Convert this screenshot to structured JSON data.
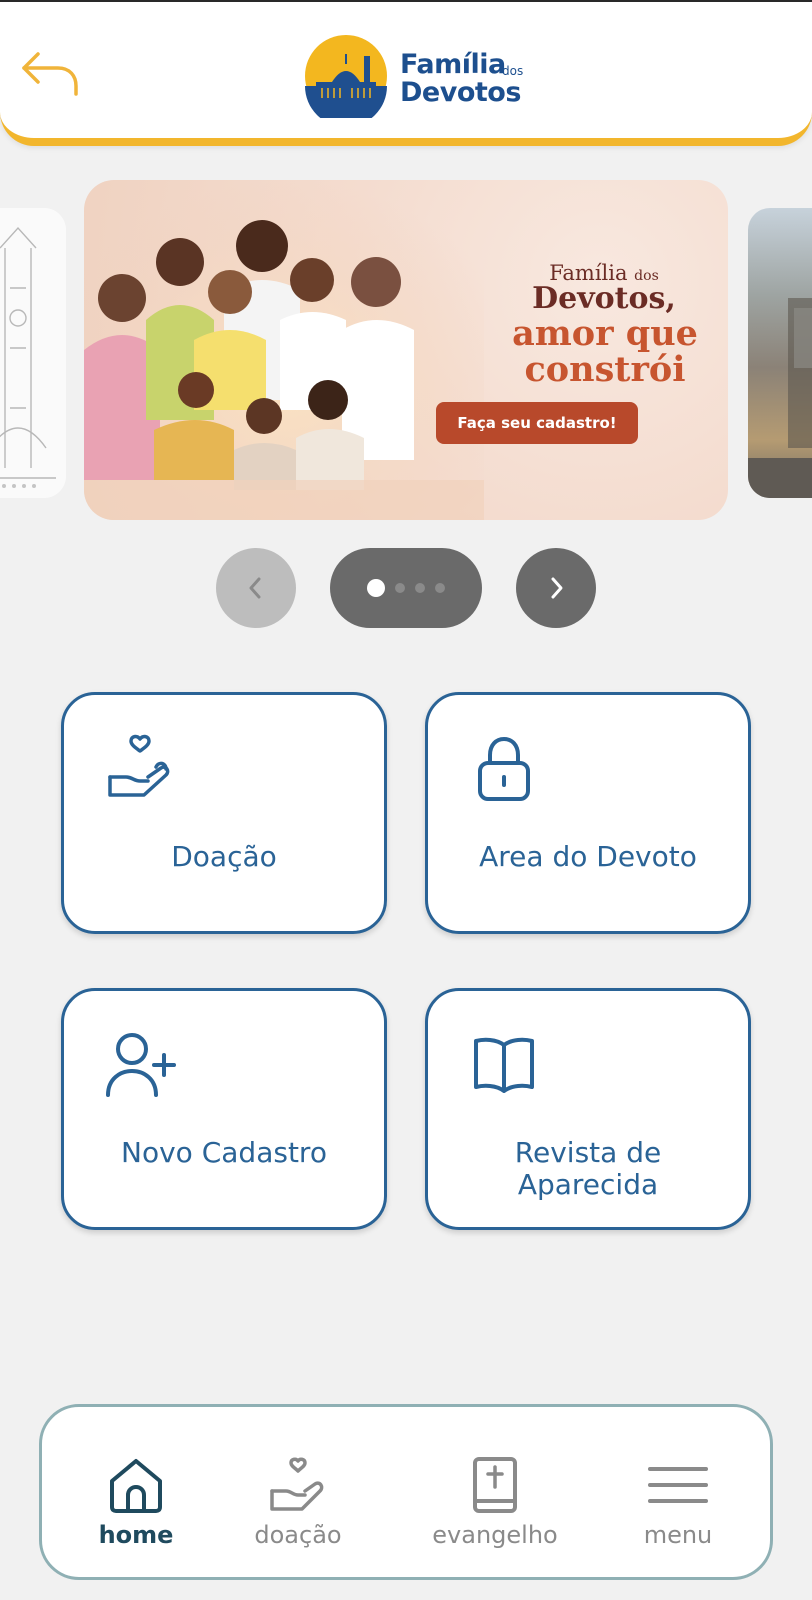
{
  "header": {
    "brand_line1": "Família",
    "brand_dos": "dos",
    "brand_line2": "Devotos"
  },
  "banner": {
    "title_line1": "Família",
    "title_dos": "dos",
    "title_line2": "Devotos,",
    "title_line3a": "amor que",
    "title_line3b": "constrói",
    "cta": "Faça seu cadastro!"
  },
  "carousel": {
    "total_slides": 4,
    "active_index": 0
  },
  "cards": {
    "doacao": "Doação",
    "area": "Area do Devoto",
    "novo": "Novo Cadastro",
    "revista_line1": "Revista de",
    "revista_line2": "Aparecida"
  },
  "nav": {
    "home": "home",
    "doacao": "doação",
    "evangelho": "evangelho",
    "menu": "menu"
  },
  "colors": {
    "accent_blue": "#2a6396",
    "brand_yellow": "#f2b62d",
    "nav_active": "#1f4a5e",
    "cta": "#b8492b"
  }
}
